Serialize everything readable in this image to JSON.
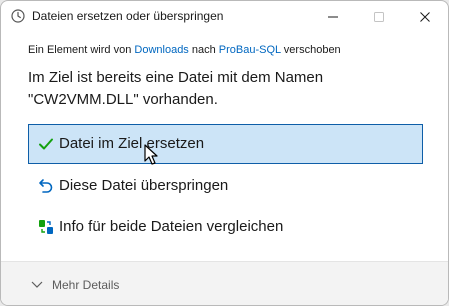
{
  "window": {
    "title": "Dateien ersetzen oder überspringen",
    "accent_color": "#0067c0"
  },
  "info": {
    "prefix": "Ein Element wird von ",
    "source": "Downloads",
    "middle": " nach ",
    "destination": "ProBau-SQL",
    "suffix": " verschoben"
  },
  "message": {
    "line1": "Im Ziel ist bereits eine Datei mit dem Namen",
    "line2": "\"CW2VMM.DLL\" vorhanden."
  },
  "options": {
    "replace": {
      "label": "Datei im Ziel ersetzen",
      "icon": "checkmark-icon",
      "selected": true
    },
    "skip": {
      "label": "Diese Datei überspringen",
      "icon": "undo-arrow-icon"
    },
    "compare": {
      "label": "Info für beide Dateien vergleichen",
      "icon": "compare-files-icon"
    }
  },
  "footer": {
    "more_details": "Mehr Details"
  }
}
